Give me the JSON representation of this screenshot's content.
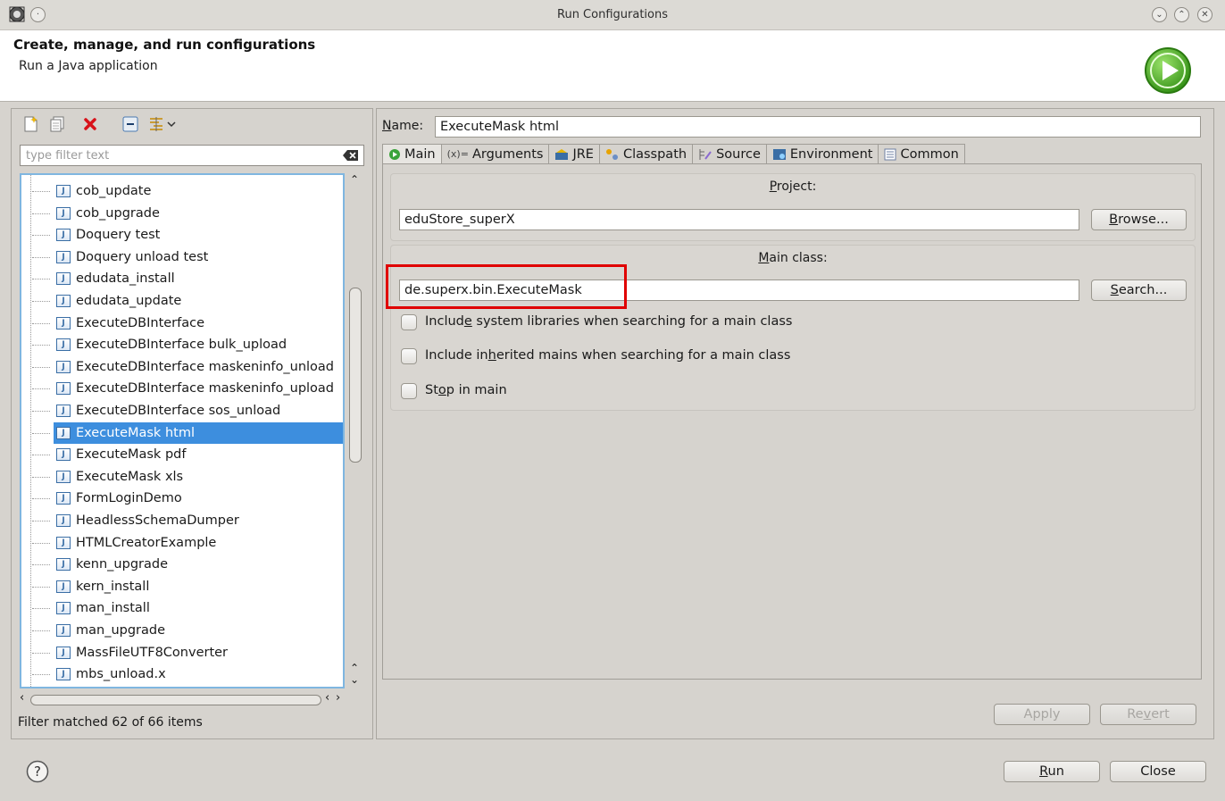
{
  "window": {
    "title": "Run Configurations",
    "controls": [
      "minimize",
      "maximize",
      "close"
    ]
  },
  "header": {
    "title": "Create, manage, and run configurations",
    "subtitle": "Run a Java application",
    "icon": "run-green-circle-icon"
  },
  "left_toolbar": {
    "icons": [
      "new-launch-configuration-icon",
      "duplicate-icon",
      "delete-icon",
      "collapse-all-icon",
      "filter-icon"
    ]
  },
  "filter": {
    "placeholder": "type filter text",
    "value": ""
  },
  "tree": {
    "items": [
      {
        "label": "cob_update",
        "selected": false
      },
      {
        "label": "cob_upgrade",
        "selected": false
      },
      {
        "label": "Doquery test",
        "selected": false
      },
      {
        "label": "Doquery unload test",
        "selected": false
      },
      {
        "label": "edudata_install",
        "selected": false
      },
      {
        "label": "edudata_update",
        "selected": false
      },
      {
        "label": "ExecuteDBInterface",
        "selected": false
      },
      {
        "label": "ExecuteDBInterface bulk_upload",
        "selected": false
      },
      {
        "label": "ExecuteDBInterface maskeninfo_unload",
        "selected": false
      },
      {
        "label": "ExecuteDBInterface maskeninfo_upload",
        "selected": false
      },
      {
        "label": "ExecuteDBInterface sos_unload",
        "selected": false
      },
      {
        "label": "ExecuteMask html",
        "selected": true
      },
      {
        "label": "ExecuteMask pdf",
        "selected": false
      },
      {
        "label": "ExecuteMask xls",
        "selected": false
      },
      {
        "label": "FormLoginDemo",
        "selected": false
      },
      {
        "label": "HeadlessSchemaDumper",
        "selected": false
      },
      {
        "label": "HTMLCreatorExample",
        "selected": false
      },
      {
        "label": "kenn_upgrade",
        "selected": false
      },
      {
        "label": "kern_install",
        "selected": false
      },
      {
        "label": "man_install",
        "selected": false
      },
      {
        "label": "man_upgrade",
        "selected": false
      },
      {
        "label": "MassFileUTF8Converter",
        "selected": false
      },
      {
        "label": "mbs_unload.x",
        "selected": false
      }
    ],
    "selection_color": "#3d8ede"
  },
  "status": "Filter matched 62 of 66 items",
  "name": {
    "label": "Name:",
    "value": "ExecuteMask html"
  },
  "tabs": [
    {
      "label": "Main",
      "icon": "main-tab-icon",
      "active": true
    },
    {
      "label": "Arguments",
      "icon": "arguments-icon",
      "active": false
    },
    {
      "label": "JRE",
      "icon": "jre-icon",
      "active": false
    },
    {
      "label": "Classpath",
      "icon": "classpath-icon",
      "active": false
    },
    {
      "label": "Source",
      "icon": "source-icon",
      "active": false
    },
    {
      "label": "Environment",
      "icon": "environment-icon",
      "active": false
    },
    {
      "label": "Common",
      "icon": "common-icon",
      "active": false
    }
  ],
  "project": {
    "title": "Project:",
    "value": "eduStore_superX",
    "browse_label": "Browse..."
  },
  "main_class": {
    "title": "Main class:",
    "value": "de.superx.bin.ExecuteMask",
    "search_label": "Search...",
    "highlight_color": "#e00000"
  },
  "options": [
    {
      "label": "Include system libraries when searching for a main class",
      "checked": false
    },
    {
      "label": "Include inherited mains when searching for a main class",
      "checked": false
    },
    {
      "label": "Stop in main",
      "checked": false
    }
  ],
  "actions": {
    "apply": "Apply",
    "revert": "Revert",
    "run": "Run",
    "close": "Close"
  },
  "help_icon": "help-icon"
}
